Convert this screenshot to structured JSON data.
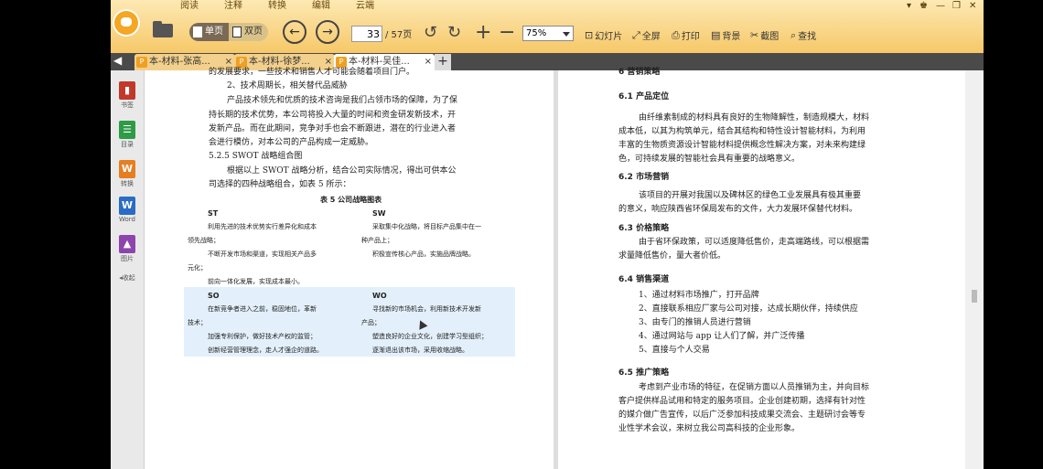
{
  "menu": [
    "阅读",
    "注释",
    "转换",
    "编辑",
    "云端"
  ],
  "toolbar": {
    "single_label": "单页",
    "double_label": "双页",
    "page_current": "33",
    "page_total": "/ 57页",
    "zoom": "75%",
    "slideshow": "幻灯片",
    "fullscreen": "全屏",
    "print": "打印",
    "background": "背景",
    "screenshot": "截图",
    "search": "查找"
  },
  "tabs": [
    {
      "label": "本-材料-张高...",
      "active": false
    },
    {
      "label": "本-材料-徐梦...",
      "active": false
    },
    {
      "label": "本-材料-吴佳...",
      "active": true
    }
  ],
  "sidebar": [
    {
      "label": "书签",
      "icon": "bookmark-icon",
      "color": "#c0392b"
    },
    {
      "label": "目录",
      "icon": "toc-icon",
      "color": "#2e9b47"
    },
    {
      "label": "转换",
      "icon": "convert-icon",
      "color": "#e67e22"
    },
    {
      "label": "Word",
      "icon": "word-icon",
      "color": "#2b6cc4"
    },
    {
      "label": "图片",
      "icon": "image-icon",
      "color": "#8e44ad"
    },
    {
      "label": "收起",
      "icon": "collapse-icon",
      "color": "#777777"
    }
  ],
  "left_page": {
    "lines": [
      "的发展要求，一些技术和销售人才可能会随着项目门户。",
      "2、技术周期长，相关替代品威胁",
      "产品技术领先和优质的技术咨询是我们占领市场的保障，为了保",
      "持长期的技术优势，本公司将投入大量的时间和资金研发新技术，开",
      "发新产品。而在此期间，竞争对手也会不断跟进，潜在的行业进入者",
      "会进行模仿，对本公司的产品构成一定威胁。",
      "5.2.5 SWOT 战略组合图",
      "根据以上 SWOT 战略分析，结合公司实际情况，得出可供本公",
      "司选择的四种战略组合，如表 5 所示："
    ],
    "table_caption": "表 5 公司战略图表",
    "st": {
      "head": "ST",
      "lines": [
        "利用先进的技术优势实行差异化和成本",
        "领先战略；",
        "不断开发市场和渠道，实现相关产品多",
        "元化；",
        "前向一体化发展，实现成本最小。"
      ]
    },
    "sw": {
      "head": "SW",
      "lines": [
        "采取集中化战略，将目标产品集中在一",
        "种产品上；",
        "积极宣传核心产品，实施品牌战略。"
      ]
    },
    "so": {
      "head": "SO",
      "lines": [
        "在新竞争者进入之前，稳固地位，革新",
        "技术；",
        "加强专利保护，做好技术产权的监管；",
        "创新经营管理理念，走人才强企的道路。"
      ]
    },
    "wo": {
      "head": "WO",
      "lines": [
        "寻找新的市场机会，利用新技术开发新",
        "产品；",
        "塑造良好的企业文化，创建学习型组织；",
        "逐渐退出该市场，采用收缩战略。"
      ]
    }
  },
  "right_page": {
    "lines": [
      {
        "t": "6 营销策略",
        "h": true,
        "i": 0
      },
      {
        "t": "6.1 产品定位",
        "h": true,
        "i": 0
      },
      {
        "t": "由纤维素制成的材料具有良好的生物降解性，制造规模大，材料",
        "h": false,
        "i": 1
      },
      {
        "t": "成本低，以其为构筑单元，结合其结构和特性设计智能材料，为利用",
        "h": false,
        "i": 0
      },
      {
        "t": "丰富的生物质资源设计智能材料提供概念性解决方案，对未来构建绿",
        "h": false,
        "i": 0
      },
      {
        "t": "色，可持续发展的智能社会具有重要的战略意义。",
        "h": false,
        "i": 0
      },
      {
        "t": "6.2 市场营销",
        "h": true,
        "i": 0
      },
      {
        "t": "该项目的开展对我国以及碑林区的绿色工业发展具有极其重要",
        "h": false,
        "i": 1
      },
      {
        "t": "的意义，响应陕西省环保局发布的文件，大力发展环保替代材料。",
        "h": false,
        "i": 0
      },
      {
        "t": "6.3 价格策略",
        "h": true,
        "i": 0
      },
      {
        "t": "由于省环保政策，可以适度降低售价，走高端路线，可以根据需",
        "h": false,
        "i": 1
      },
      {
        "t": "求量降低售价，量大者价低。",
        "h": false,
        "i": 0
      },
      {
        "t": "6.4 销售渠道",
        "h": true,
        "i": 0
      },
      {
        "t": "1、通过材料市场推广，打开品牌",
        "h": false,
        "i": 1
      },
      {
        "t": "2、直接联系相应厂家与公司对接，达成长期伙伴，持续供应",
        "h": false,
        "i": 1
      },
      {
        "t": "3、由专门的推销人员进行营销",
        "h": false,
        "i": 1
      },
      {
        "t": "4、通过网站与 app 让人们了解，并广泛传播",
        "h": false,
        "i": 1
      },
      {
        "t": "5、直接与个人交易",
        "h": false,
        "i": 1
      },
      {
        "t": "6.5 推广策略",
        "h": true,
        "i": 0
      },
      {
        "t": "考虑到产业市场的特征，在促销方面以人员推销为主，并向目标",
        "h": false,
        "i": 1
      },
      {
        "t": "客户提供样品试用和特定的服务项目。企业创建初期，选择有针对性",
        "h": false,
        "i": 0
      },
      {
        "t": "的媒介做广告宣传，以后广泛参加科技成果交流会、主题研讨会等专",
        "h": false,
        "i": 0
      },
      {
        "t": "业性学术会议，来树立我公司高科技的企业形象。",
        "h": false,
        "i": 0
      }
    ]
  }
}
